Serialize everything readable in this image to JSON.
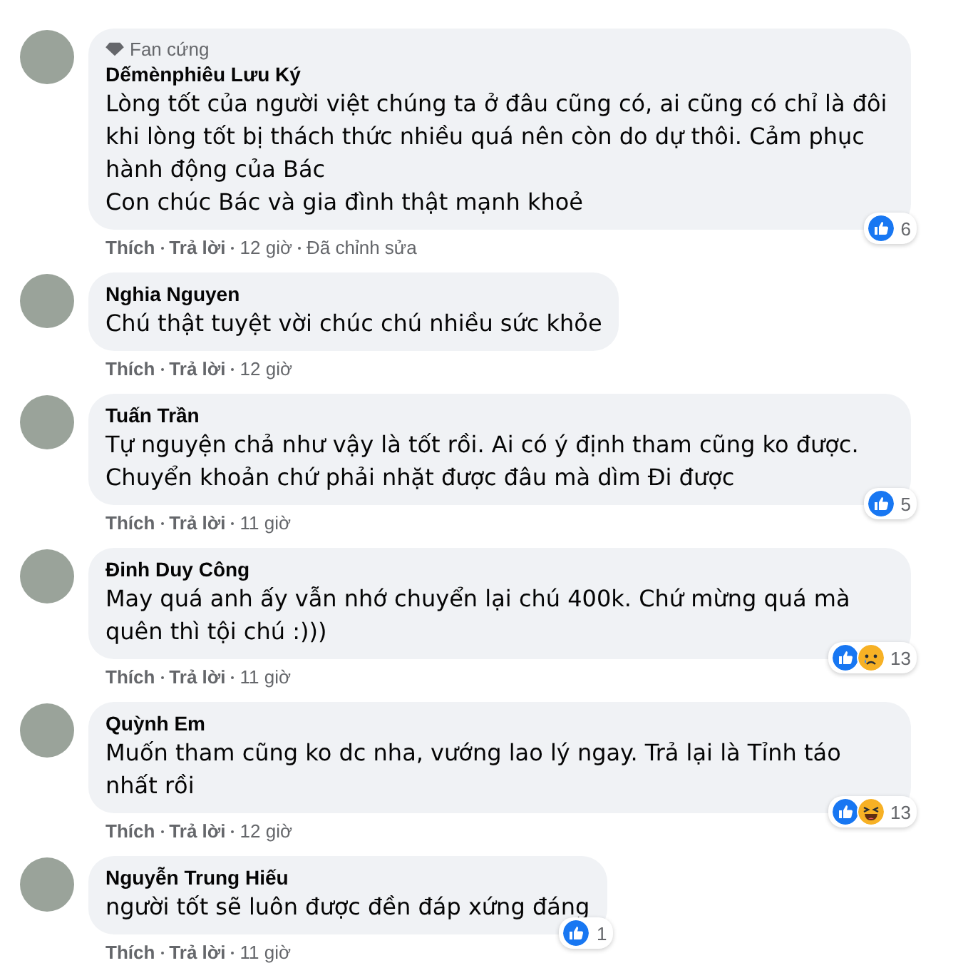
{
  "comments": [
    {
      "badge": "Fan cứng",
      "name": "Dếmènphiêu Lưu Ký",
      "lines": [
        "Lòng tốt của người việt chúng ta ở đâu cũng có, ai cũng có chỉ là đôi khi lòng tốt bị thách thức nhiều quá nên còn do dự thôi. Cảm phục hành động của Bác",
        "Con chúc Bác và gia đình thật mạnh khoẻ"
      ],
      "reactions": [
        {
          "kind": "like"
        }
      ],
      "reaction_count": "6",
      "actions": [
        "Thích",
        "Trả lời"
      ],
      "time": "12 giờ",
      "edited": "Đã chỉnh sửa"
    },
    {
      "name": "Nghia Nguyen",
      "lines": [
        "Chú thật tuyệt vời chúc chú nhiều sức khỏe"
      ],
      "actions": [
        "Thích",
        "Trả lời"
      ],
      "time": "12 giờ"
    },
    {
      "name": "Tuấn Trần",
      "lines": [
        "Tự nguyện chả như vậy là tốt rồi. Ai có ý định tham cũng ko được. Chuyển khoản chứ phải nhặt được đâu mà dìm Đi được"
      ],
      "reactions": [
        {
          "kind": "like"
        }
      ],
      "reaction_count": "5",
      "actions": [
        "Thích",
        "Trả lời"
      ],
      "time": "11 giờ"
    },
    {
      "name": "Đinh Duy Công",
      "lines": [
        "May quá anh ấy vẫn nhớ chuyển lại chú 400k. Chứ mừng quá mà quên thì tội chú :)))"
      ],
      "reactions": [
        {
          "kind": "like"
        },
        {
          "kind": "sad"
        }
      ],
      "reaction_count": "13",
      "actions": [
        "Thích",
        "Trả lời"
      ],
      "time": "11 giờ"
    },
    {
      "name": "Quỳnh Em",
      "lines": [
        "Muốn tham cũng ko dc nha, vướng lao lý ngay. Trả lại là Tỉnh táo nhất rồi"
      ],
      "reactions": [
        {
          "kind": "like"
        },
        {
          "kind": "haha"
        }
      ],
      "reaction_count": "13",
      "actions": [
        "Thích",
        "Trả lời"
      ],
      "time": "12 giờ"
    },
    {
      "name": "Nguyễn Trung Hiếu",
      "lines": [
        "người tốt sẽ luôn được đền đáp xứng đáng"
      ],
      "reactions": [
        {
          "kind": "like"
        }
      ],
      "reaction_count": "1",
      "actions": [
        "Thích",
        "Trả lời"
      ],
      "time": "11 giờ"
    }
  ]
}
